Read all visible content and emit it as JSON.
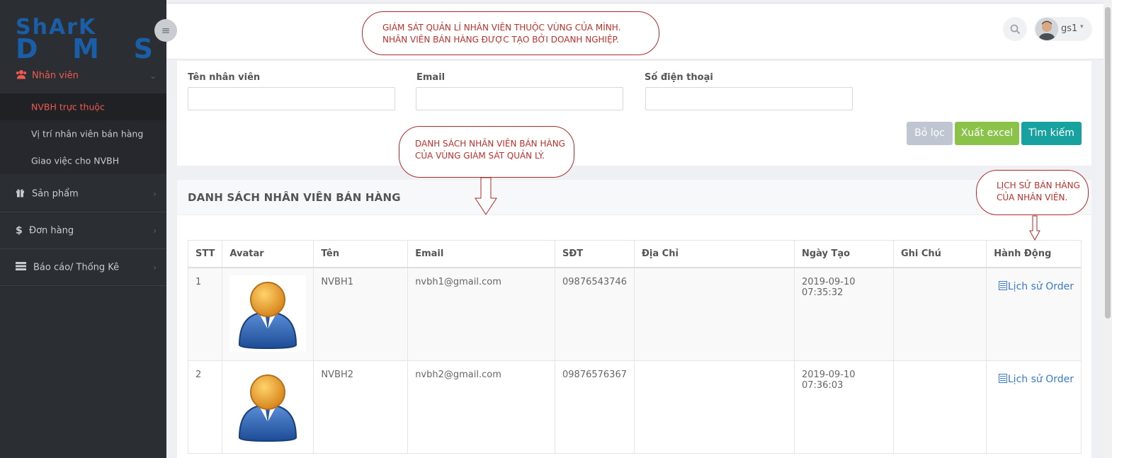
{
  "sidebar": {
    "logo_text_top": "ShArK",
    "logo_text_bottom": "DMS",
    "menu": [
      {
        "label": "Nhân viên",
        "icon": "users-icon"
      },
      {
        "label": "Sản phẩm",
        "icon": "gift-icon"
      },
      {
        "label": "Đơn hàng",
        "icon": "dollar-icon"
      },
      {
        "label": "Báo cáo/ Thống Kê",
        "icon": "report-icon"
      }
    ],
    "submenu": [
      {
        "label": "NVBH trực thuộc"
      },
      {
        "label": "Vị trí nhân viên bán hàng"
      },
      {
        "label": "Giao việc cho NVBH"
      }
    ]
  },
  "header": {
    "user_name": "gs1"
  },
  "filter": {
    "name_label": "Tên nhân viên",
    "email_label": "Email",
    "phone_label": "Số điện thoại",
    "name_value": "",
    "email_value": "",
    "phone_value": "",
    "btn_clear": "Bỏ lọc",
    "btn_export": "Xuất excel",
    "btn_search": "Tìm kiếm"
  },
  "list": {
    "title": "DANH SÁCH NHÂN VIÊN BÁN HÀNG",
    "columns": [
      "STT",
      "Avatar",
      "Tên",
      "Email",
      "SĐT",
      "Địa Chỉ",
      "Ngày Tạo",
      "Ghi Chú",
      "Hành Động"
    ],
    "rows": [
      {
        "stt": "1",
        "name": "NVBH1",
        "email": "nvbh1@gmail.com",
        "phone": "09876543746",
        "address": "",
        "created": "2019-09-10 07:35:32",
        "note": "",
        "action": "Lịch sử Order"
      },
      {
        "stt": "2",
        "name": "NVBH2",
        "email": "nvbh2@gmail.com",
        "phone": "09876576367",
        "address": "",
        "created": "2019-09-10 07:36:03",
        "note": "",
        "action": "Lịch sử Order"
      }
    ]
  },
  "annotations": {
    "top_line1": "GIÁM SÁT QUẢN LÍ NHÂN VIÊN THUỘC VÙNG CỦA MÌNH.",
    "top_line2": "NHÂN VIÊN BÁN HÀNG ĐƯỢC TẠO BỞI DOANH NGHIỆP.",
    "list_line1": "DANH SÁCH NHÂN VIÊN BÁN HÀNG",
    "list_line2": "CỦA VÙNG GIÁM SÁT QUẢN LÝ.",
    "history_line1": "LỊCH SỬ BÁN HÀNG",
    "history_line2": "CỦA NHÂN VIÊN."
  },
  "colors": {
    "sidebar_bg": "#2b2e33",
    "active_accent": "#ee5a4f",
    "logo_blue": "#1b5ea8",
    "btn_clear": "#bfc6d1",
    "btn_export": "#8bc34a",
    "btn_search": "#17a2a0",
    "link": "#3a7bc8",
    "annotation": "#c0302b"
  }
}
